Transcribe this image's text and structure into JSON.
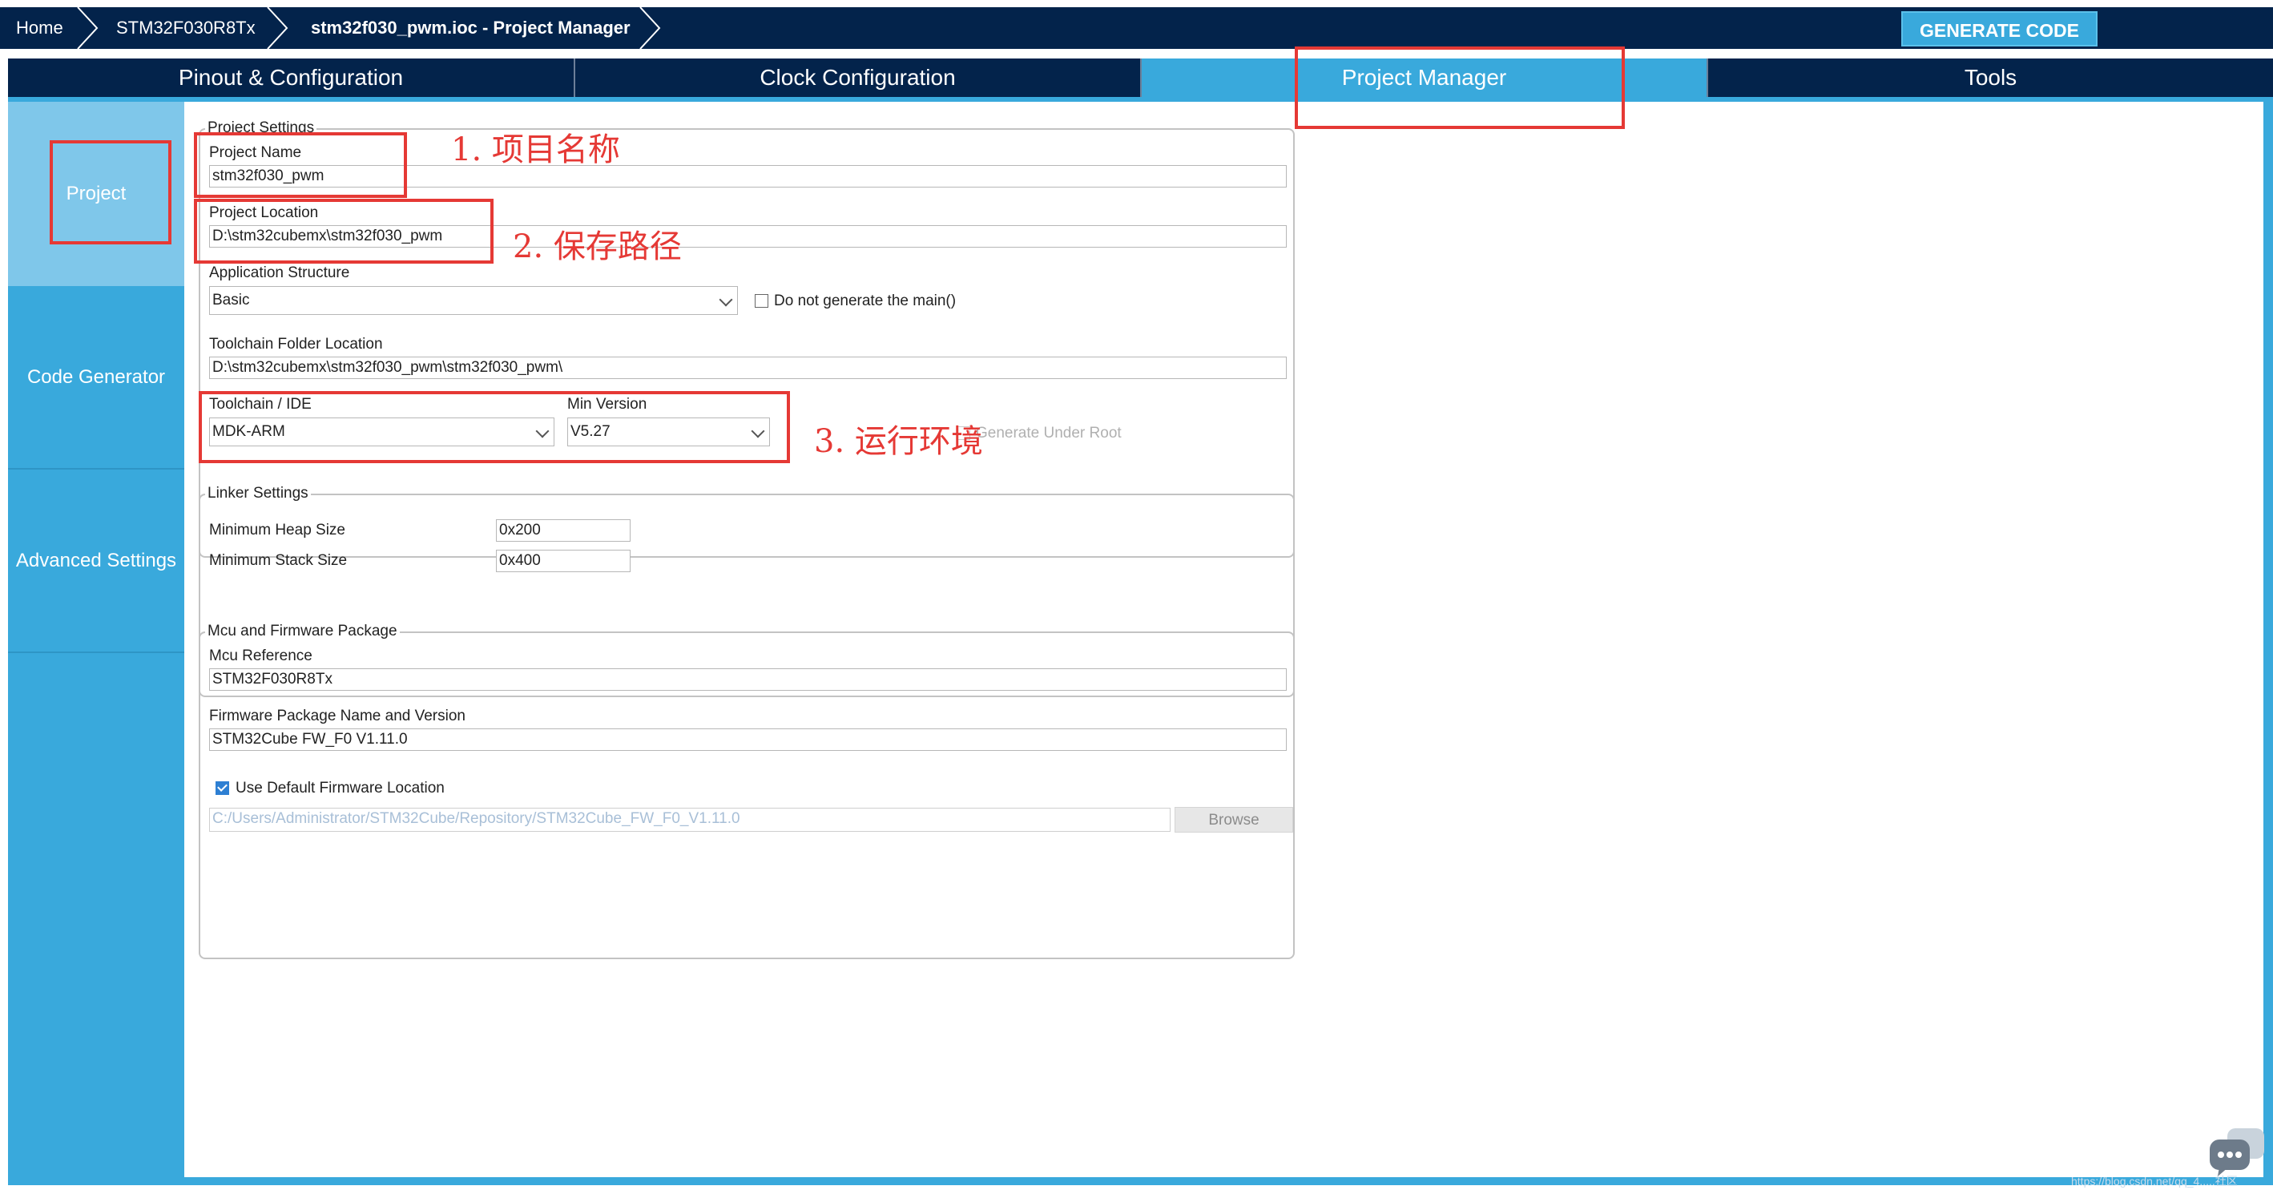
{
  "breadcrumb": {
    "items": [
      "Home",
      "STM32F030R8Tx",
      "stm32f030_pwm.ioc - Project Manager"
    ]
  },
  "header": {
    "generate_code_label": "GENERATE CODE"
  },
  "tabs": [
    {
      "label": "Pinout & Configuration"
    },
    {
      "label": "Clock Configuration"
    },
    {
      "label": "Project Manager",
      "active": true
    },
    {
      "label": "Tools"
    }
  ],
  "sidebar": {
    "items": [
      {
        "label": "Project",
        "active": true
      },
      {
        "label": "Code Generator"
      },
      {
        "label": "Advanced Settings"
      }
    ]
  },
  "project_settings": {
    "title": "Project Settings",
    "project_name_label": "Project Name",
    "project_name_value": "stm32f030_pwm",
    "project_location_label": "Project Location",
    "project_location_value": "D:\\stm32cubemx\\stm32f030_pwm",
    "app_structure_label": "Application Structure",
    "app_structure_value": "Basic",
    "no_main_label": "Do not generate the main()",
    "toolchain_folder_label": "Toolchain Folder Location",
    "toolchain_folder_value": "D:\\stm32cubemx\\stm32f030_pwm\\stm32f030_pwm\\",
    "toolchain_ide_label": "Toolchain / IDE",
    "toolchain_ide_value": "MDK-ARM",
    "min_version_label": "Min Version",
    "min_version_value": "V5.27",
    "generate_under_root_label": "Generate Under Root"
  },
  "linker_settings": {
    "title": "Linker Settings",
    "heap_label": "Minimum Heap Size",
    "heap_value": "0x200",
    "stack_label": "Minimum Stack Size",
    "stack_value": "0x400"
  },
  "mcu_package": {
    "title": "Mcu and Firmware Package",
    "mcu_ref_label": "Mcu Reference",
    "mcu_ref_value": "STM32F030R8Tx",
    "fw_name_label": "Firmware Package Name and Version",
    "fw_name_value": "STM32Cube FW_F0 V1.11.0",
    "use_default_label": "Use Default Firmware Location",
    "fw_path_value": "C:/Users/Administrator/STM32Cube/Repository/STM32Cube_FW_F0_V1.11.0",
    "browse_label": "Browse"
  },
  "annotations": {
    "a1": "1. 项目名称",
    "a2": "2. 保存路径",
    "a3": "3. 运行环境"
  },
  "colors": {
    "navy": "#03234b",
    "accent": "#39a9dc",
    "active_side": "#7fc7ea",
    "annotation_red": "#e53935"
  },
  "watermark": "https://blog.csdn.net/qq_4.....社区"
}
